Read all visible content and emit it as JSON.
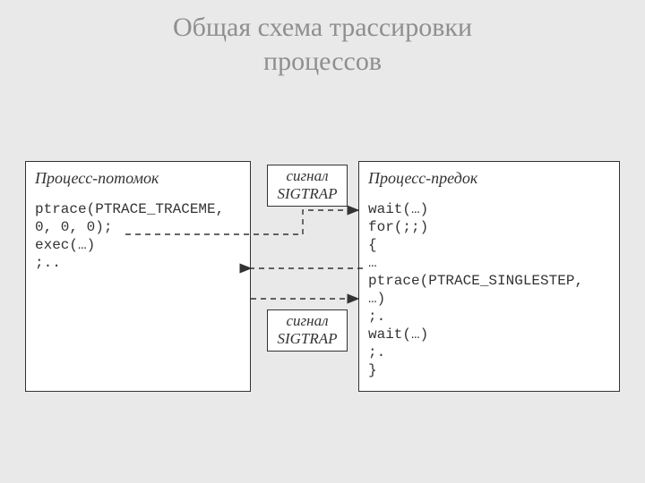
{
  "title_line1": "Общая схема трассировки",
  "title_line2": "процессов",
  "left": {
    "heading": "Процесс-потомок",
    "code": "ptrace(PTRACE_TRACEME,\n0, 0, 0);\nexec(…)\n;.."
  },
  "right": {
    "heading": "Процесс-предок",
    "code": "wait(…)\nfor(;;)\n{\n…\nptrace(PTRACE_SINGLESTEP,\n…)\n;.\nwait(…)\n;.\n}"
  },
  "label_top_line1": "сигнал",
  "label_top_line2": "SIGTRAP",
  "label_bot_line1": "сигнал",
  "label_bot_line2": "SIGTRAP"
}
